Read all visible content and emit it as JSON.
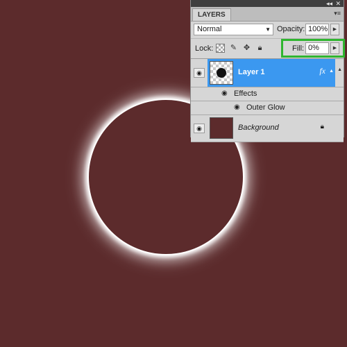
{
  "panel": {
    "tab_label": "LAYERS",
    "collapse_icon": "double-chevron-icon",
    "close_icon": "close-icon",
    "menu_icon": "panel-menu-icon"
  },
  "blend": {
    "mode": "Normal",
    "opacity_label": "Opacity:",
    "opacity_value": "100%"
  },
  "lock": {
    "label": "Lock:",
    "icons": [
      "lock-transparent-icon",
      "lock-brush-icon",
      "lock-move-icon",
      "lock-all-icon"
    ],
    "fill_label": "Fill:",
    "fill_value": "0%"
  },
  "layers": [
    {
      "name": "Layer 1",
      "selected": true,
      "effects_label": "Effects",
      "effects": [
        "Outer Glow"
      ]
    },
    {
      "name": "Background",
      "locked": true
    }
  ],
  "colors": {
    "canvas_bg": "#5c2b2c",
    "selection": "#3b98f0",
    "highlight_box": "#2fb52f",
    "glow": "#ffffff"
  }
}
